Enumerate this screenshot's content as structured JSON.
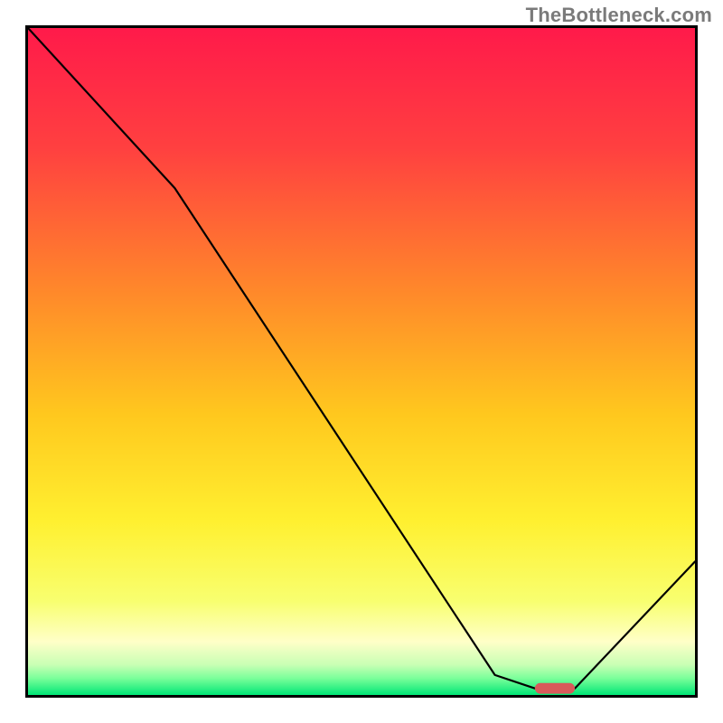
{
  "watermark": "TheBottleneck.com",
  "colors": {
    "border": "#000000",
    "curve": "#000000",
    "marker": "#d85a5a",
    "gradient_stops": [
      {
        "offset": 0.0,
        "color": "#ff1a4a"
      },
      {
        "offset": 0.18,
        "color": "#ff4040"
      },
      {
        "offset": 0.4,
        "color": "#ff8a2a"
      },
      {
        "offset": 0.58,
        "color": "#ffc81e"
      },
      {
        "offset": 0.74,
        "color": "#fff030"
      },
      {
        "offset": 0.86,
        "color": "#f8ff70"
      },
      {
        "offset": 0.92,
        "color": "#ffffc8"
      },
      {
        "offset": 0.955,
        "color": "#c8ffb4"
      },
      {
        "offset": 0.975,
        "color": "#7aff9a"
      },
      {
        "offset": 1.0,
        "color": "#00e676"
      }
    ]
  },
  "chart_data": {
    "type": "line",
    "title": "",
    "xlabel": "",
    "ylabel": "",
    "xlim": [
      0,
      100
    ],
    "ylim": [
      0,
      100
    ],
    "grid": false,
    "series": [
      {
        "name": "curve",
        "x": [
          0,
          22,
          70,
          76,
          82,
          100
        ],
        "y": [
          100,
          76,
          3,
          1,
          1,
          20
        ]
      }
    ],
    "marker": {
      "x_start": 76,
      "x_end": 82,
      "y": 1
    }
  }
}
